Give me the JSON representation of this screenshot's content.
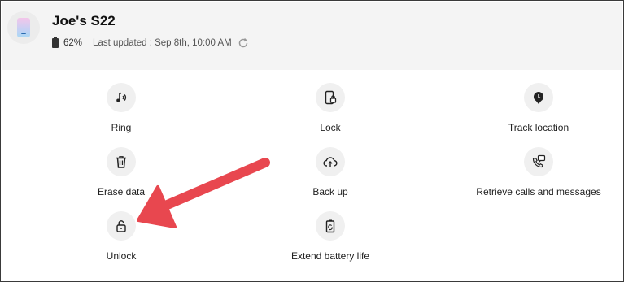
{
  "device": {
    "name": "Joe's S22",
    "battery": "62%",
    "last_updated": "Last updated : Sep 8th, 10:00 AM"
  },
  "actions": {
    "ring": {
      "label": "Ring",
      "icon": "ring-icon"
    },
    "lock": {
      "label": "Lock",
      "icon": "lock-phone-icon"
    },
    "track": {
      "label": "Track location",
      "icon": "location-pin-icon"
    },
    "erase": {
      "label": "Erase data",
      "icon": "trash-icon"
    },
    "backup": {
      "label": "Back up",
      "icon": "cloud-upload-icon"
    },
    "retrieve": {
      "label": "Retrieve calls and messages",
      "icon": "call-message-icon"
    },
    "unlock": {
      "label": "Unlock",
      "icon": "unlock-icon"
    },
    "battery_life": {
      "label": "Extend battery life",
      "icon": "battery-recycle-icon"
    }
  },
  "annotation": {
    "color": "#e8474f",
    "target": "unlock"
  }
}
